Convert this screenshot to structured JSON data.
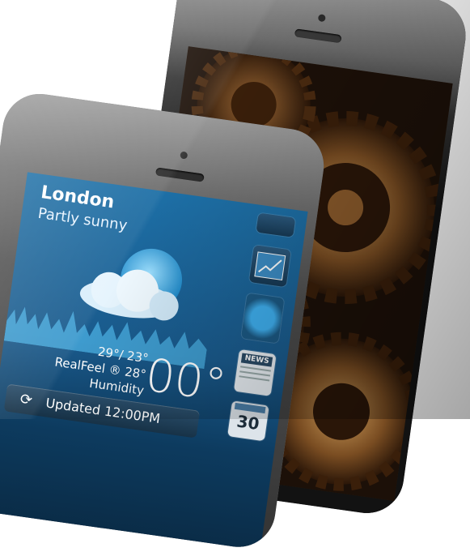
{
  "weather": {
    "city": "London",
    "condition": "Partly sunny",
    "temp_range": "29°/ 23°",
    "realfeel": "RealFeel ® 28°",
    "humidity_label": "Humidity",
    "big_temp": "00°",
    "updated": "Updated 12:00PM"
  },
  "widgets": {
    "news_label": "NEWS",
    "calendar_number": "30"
  },
  "icons": {
    "refresh": "refresh-icon",
    "weather": "partly-sunny-icon",
    "chart": "chart-up-icon",
    "news": "newspaper-icon",
    "calendar": "calendar-icon"
  },
  "colors": {
    "screen_blue": "#1d6fa6",
    "gears_bronze": "#8a5a2b"
  }
}
